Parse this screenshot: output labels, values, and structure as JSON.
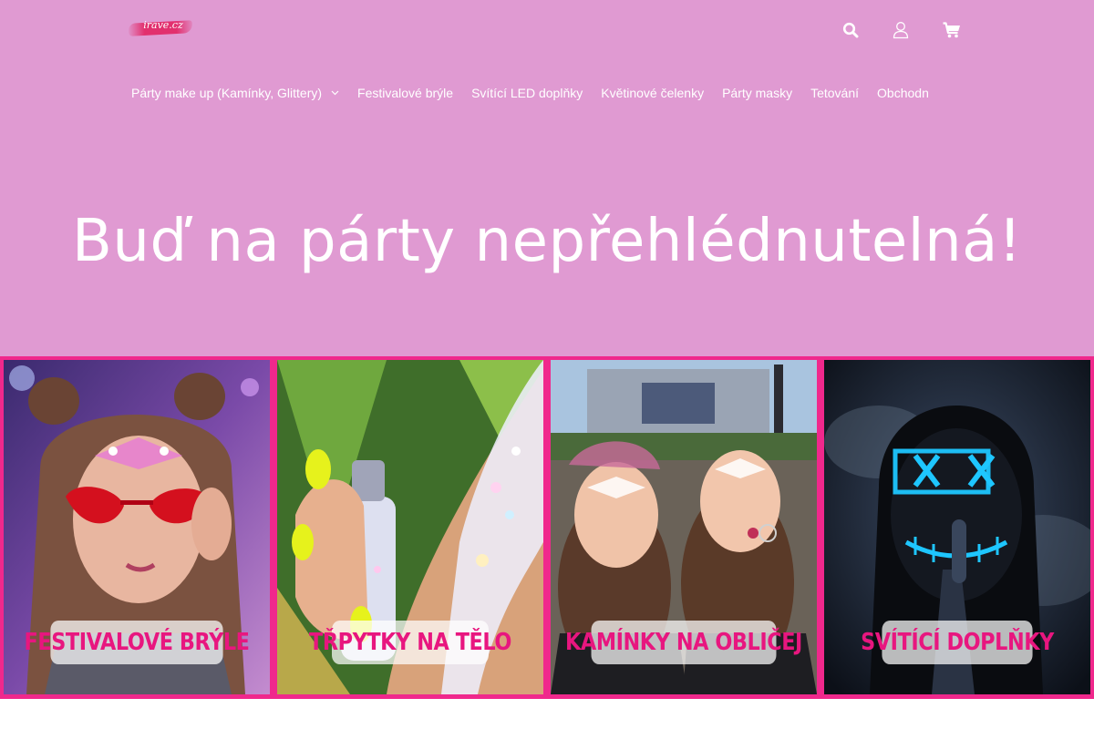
{
  "header": {
    "logo_text": "irave.cz",
    "icons": [
      "search-icon",
      "user-icon",
      "cart-icon"
    ]
  },
  "nav": {
    "items": [
      {
        "label": "Párty make up (Kamínky, Glittery)",
        "has_dropdown": true
      },
      {
        "label": "Festivalové brýle"
      },
      {
        "label": "Svítící LED doplňky"
      },
      {
        "label": "Květinové čelenky"
      },
      {
        "label": "Párty masky"
      },
      {
        "label": "Tetování"
      },
      {
        "label": "Obchodn"
      }
    ]
  },
  "hero": {
    "title": "Buď na párty nepřehlédnutelná!"
  },
  "categories": [
    {
      "label": "FESTIVALOVÉ BRÝLE"
    },
    {
      "label": "TŘPYTKY NA TĚLO"
    },
    {
      "label": "KAMÍNKY NA OBLIČEJ"
    },
    {
      "label": "SVÍTÍCÍ DOPLŇKY"
    }
  ],
  "colors": {
    "header_bg": "#e09ad2",
    "accent_pink": "#f0288c",
    "label_text": "#e8167f",
    "text_white": "#ffffff"
  }
}
